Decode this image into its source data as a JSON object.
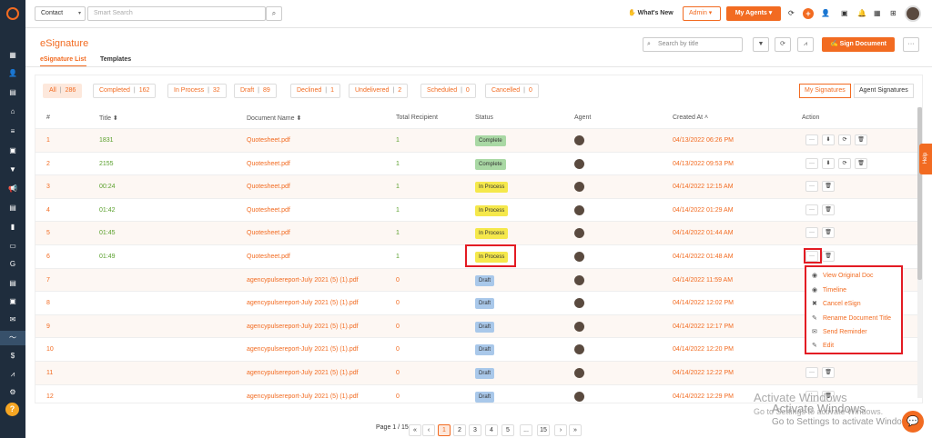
{
  "topbar": {
    "contact_select": "Contact",
    "search_placeholder": "Smart Search",
    "whats_new": "What's New",
    "admin": "Admin",
    "my_agents": "My Agents"
  },
  "page": {
    "title": "eSignature",
    "tabs": [
      "eSignature List",
      "Templates"
    ],
    "title_search_placeholder": "Search by title",
    "sign_document": "Sign Document"
  },
  "filters": [
    {
      "label": "All",
      "count": "286"
    },
    {
      "label": "Completed",
      "count": "162"
    },
    {
      "label": "In Process",
      "count": "32"
    },
    {
      "label": "Draft",
      "count": "89"
    },
    {
      "label": "Declined",
      "count": "1"
    },
    {
      "label": "Undelivered",
      "count": "2"
    },
    {
      "label": "Scheduled",
      "count": "0"
    },
    {
      "label": "Cancelled",
      "count": "0"
    }
  ],
  "signature_toggle": [
    "My Signatures",
    "Agent Signatures"
  ],
  "table": {
    "headers": [
      "#",
      "Title ⬍",
      "Document Name ⬍",
      "Total Recipient",
      "Status",
      "Agent",
      "Created At ˄",
      "Action"
    ],
    "rows": [
      {
        "num": "1",
        "title": "1831",
        "doc": "Quotesheet.pdf",
        "recipients": "1",
        "status": "Complete",
        "date": "04/13/2022 06:26 PM"
      },
      {
        "num": "2",
        "title": "2155",
        "doc": "Quotesheet.pdf",
        "recipients": "1",
        "status": "Complete",
        "date": "04/13/2022 09:53 PM"
      },
      {
        "num": "3",
        "title": "00:24",
        "doc": "Quotesheet.pdf",
        "recipients": "1",
        "status": "In Process",
        "date": "04/14/2022 12:15 AM"
      },
      {
        "num": "4",
        "title": "01:42",
        "doc": "Quotesheet.pdf",
        "recipients": "1",
        "status": "In Process",
        "date": "04/14/2022 01:29 AM"
      },
      {
        "num": "5",
        "title": "01:45",
        "doc": "Quotesheet.pdf",
        "recipients": "1",
        "status": "In Process",
        "date": "04/14/2022 01:44 AM"
      },
      {
        "num": "6",
        "title": "01:49",
        "doc": "Quotesheet.pdf",
        "recipients": "1",
        "status": "In Process",
        "date": "04/14/2022 01:48 AM"
      },
      {
        "num": "7",
        "title": "",
        "doc": "agencypulsereport-July 2021 (5) (1).pdf",
        "recipients": "0",
        "status": "Draft",
        "date": "04/14/2022 11:59 AM"
      },
      {
        "num": "8",
        "title": "",
        "doc": "agencypulsereport-July 2021 (5) (1).pdf",
        "recipients": "0",
        "status": "Draft",
        "date": "04/14/2022 12:02 PM"
      },
      {
        "num": "9",
        "title": "",
        "doc": "agencypulsereport-July 2021 (5) (1).pdf",
        "recipients": "0",
        "status": "Draft",
        "date": "04/14/2022 12:17 PM"
      },
      {
        "num": "10",
        "title": "",
        "doc": "agencypulsereport-July 2021 (5) (1).pdf",
        "recipients": "0",
        "status": "Draft",
        "date": "04/14/2022 12:20 PM"
      },
      {
        "num": "11",
        "title": "",
        "doc": "agencypulsereport-July 2021 (5) (1).pdf",
        "recipients": "0",
        "status": "Draft",
        "date": "04/14/2022 12:22 PM"
      },
      {
        "num": "12",
        "title": "",
        "doc": "agencypulsereport-July 2021 (5) (1).pdf",
        "recipients": "0",
        "status": "Draft",
        "date": "04/14/2022 12:29 PM"
      }
    ]
  },
  "action_menu": [
    "View Original Doc",
    "Timeline",
    "Cancel eSign",
    "Rename Document Title",
    "Send Reminder",
    "Edit"
  ],
  "pagination": {
    "label": "Page 1 / 15",
    "pages": [
      "1",
      "2",
      "3",
      "4",
      "5",
      "...",
      "15"
    ]
  },
  "watermark": {
    "line1": "Activate Windows",
    "line2": "Go to Settings to activate Windows."
  },
  "help_tab": "Help",
  "colors": {
    "accent": "#f26b21",
    "sidebar": "#1f2d3d",
    "complete": "#a9d8a4",
    "in_process": "#f5e84b",
    "draft": "#a9c8ea",
    "highlight": "#e31b23"
  }
}
